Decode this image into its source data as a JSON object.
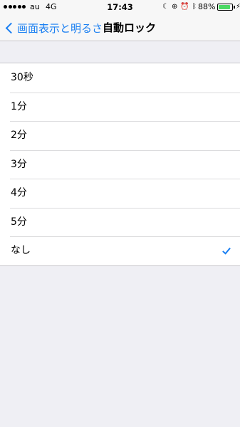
{
  "status_bar": {
    "carrier": "au",
    "network": "4G",
    "time": "17:43",
    "battery_percent": "88%",
    "battery_level": 0.88,
    "icons": [
      "moon-icon",
      "rotation-lock-icon",
      "alarm-icon",
      "bluetooth-icon",
      "charging-icon"
    ]
  },
  "nav": {
    "back_label": "画面表示と明るさ",
    "title": "自動ロック"
  },
  "options": [
    {
      "label": "30秒",
      "selected": false
    },
    {
      "label": "1分",
      "selected": false
    },
    {
      "label": "2分",
      "selected": false
    },
    {
      "label": "3分",
      "selected": false
    },
    {
      "label": "4分",
      "selected": false
    },
    {
      "label": "5分",
      "selected": false
    },
    {
      "label": "なし",
      "selected": true
    }
  ],
  "colors": {
    "accent": "#1a7ff2",
    "background": "#efeff4",
    "battery": "#4cd964"
  }
}
